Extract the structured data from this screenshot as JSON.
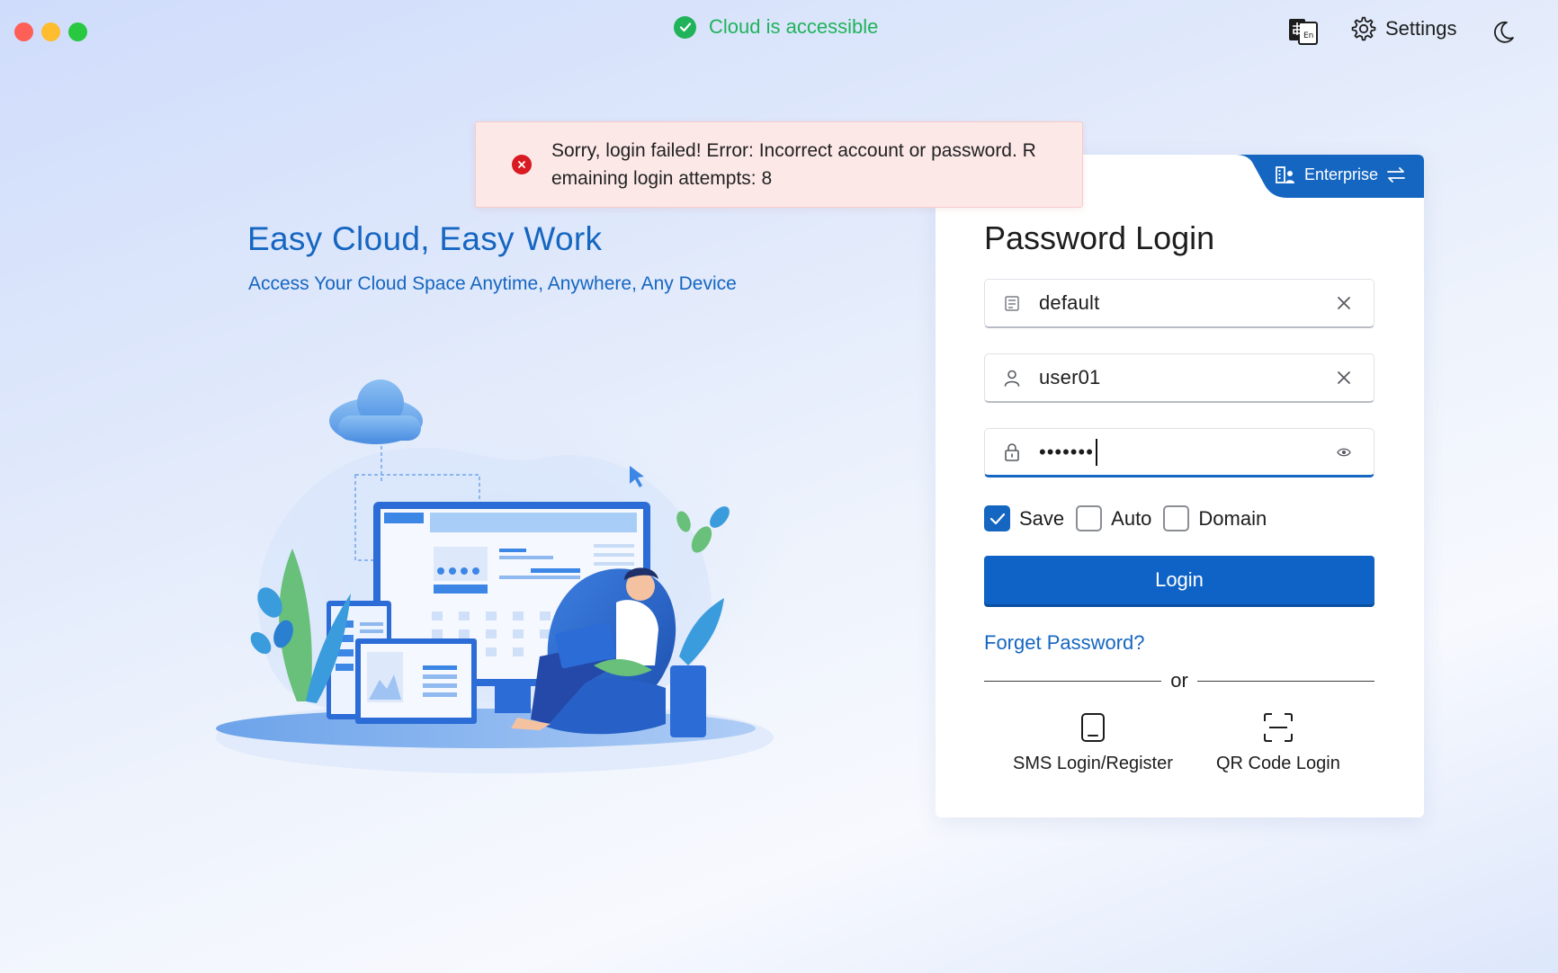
{
  "status": {
    "cloud_text": "Cloud is accessible"
  },
  "toolbar": {
    "settings_label": "Settings"
  },
  "hero": {
    "title": "Easy Cloud, Easy Work",
    "subtitle": "Access Your Cloud Space Anytime, Anywhere, Any Device"
  },
  "toast": {
    "message": "Sorry, login failed! Error: Incorrect account or password. Remaining login attempts: 8"
  },
  "card": {
    "mode_tab_label": "Enterprise",
    "title": "Password Login",
    "fields": {
      "domain_value": "default",
      "username_value": "user01",
      "password_masked": "•••••••"
    },
    "options": [
      {
        "label": "Save",
        "checked": true
      },
      {
        "label": "Auto",
        "checked": false
      },
      {
        "label": "Domain",
        "checked": false
      }
    ],
    "login_button": "Login",
    "forgot_link": "Forget Password?",
    "divider_text": "or",
    "alt_methods": {
      "sms_label": "SMS Login/Register",
      "qr_label": "QR Code Login"
    }
  },
  "colors": {
    "accent": "#1566c1",
    "success": "#21b35a",
    "error": "#d81b22",
    "toast_bg": "#fde8e8"
  },
  "icons": {
    "status": "check-circle-icon",
    "language": "language-switch-icon",
    "settings": "gear-icon",
    "theme": "moon-icon",
    "enterprise": "building-user-icon",
    "switch": "swap-arrows-icon",
    "domain": "server-icon",
    "user": "user-icon",
    "password": "lock-icon",
    "clear": "close-icon",
    "reveal": "eye-icon",
    "sms": "phone-icon",
    "qr": "qr-scan-icon",
    "error": "error-circle-icon"
  }
}
